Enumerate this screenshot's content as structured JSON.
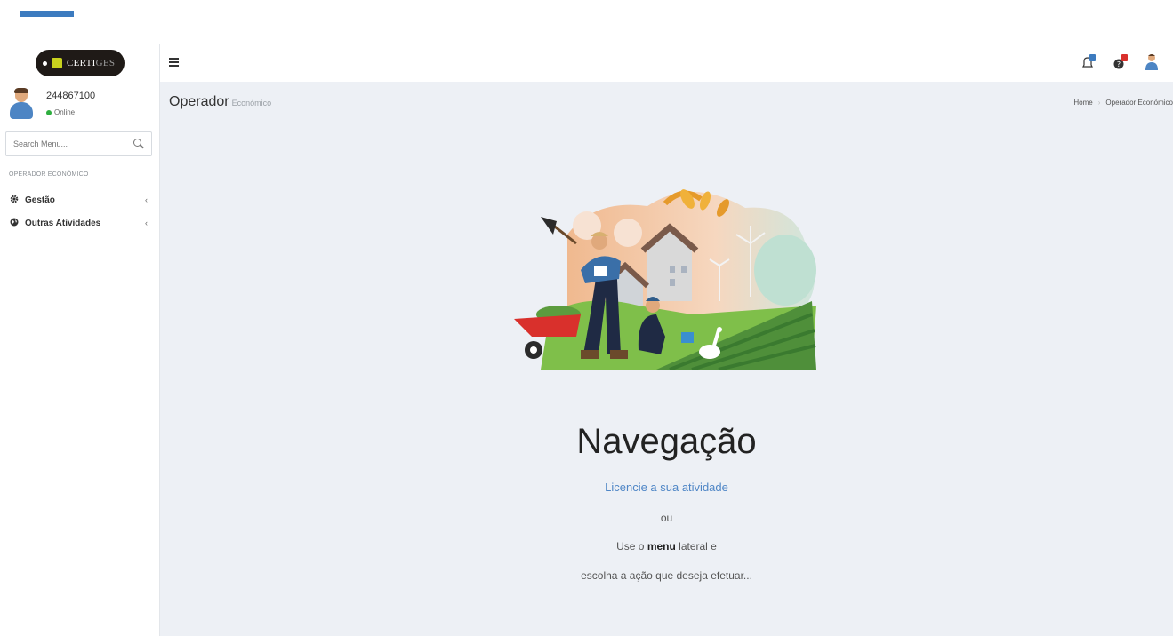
{
  "brand": {
    "logo_text_main": "CERTI",
    "logo_text_dim": "GES"
  },
  "user": {
    "name": "244867100",
    "status": "Online"
  },
  "search": {
    "placeholder": "Search Menu..."
  },
  "sidebar": {
    "section_header": "OPERADOR ECONÓMICO",
    "items": [
      {
        "label": "Gestão",
        "icon": "gear-icon"
      },
      {
        "label": "Outras Atividades",
        "icon": "globe-icon"
      }
    ]
  },
  "header": {
    "icons": [
      "bell-icon",
      "question-icon",
      "user-icon"
    ]
  },
  "page": {
    "title": "Operador",
    "subtitle": "Económico",
    "breadcrumb": [
      "Home",
      "Operador Económico"
    ]
  },
  "main": {
    "heading": "Navegação",
    "link": "Licencie a sua atividade",
    "or": "ou",
    "line1_prefix": "Use o ",
    "line1_bold": "menu",
    "line1_suffix": " lateral e",
    "line2": "escolha a ação que deseja efetuar..."
  },
  "colors": {
    "accent": "#3c7bbf",
    "content_bg": "#edf0f5",
    "online": "#2eae3f",
    "link": "#4f86c6"
  }
}
